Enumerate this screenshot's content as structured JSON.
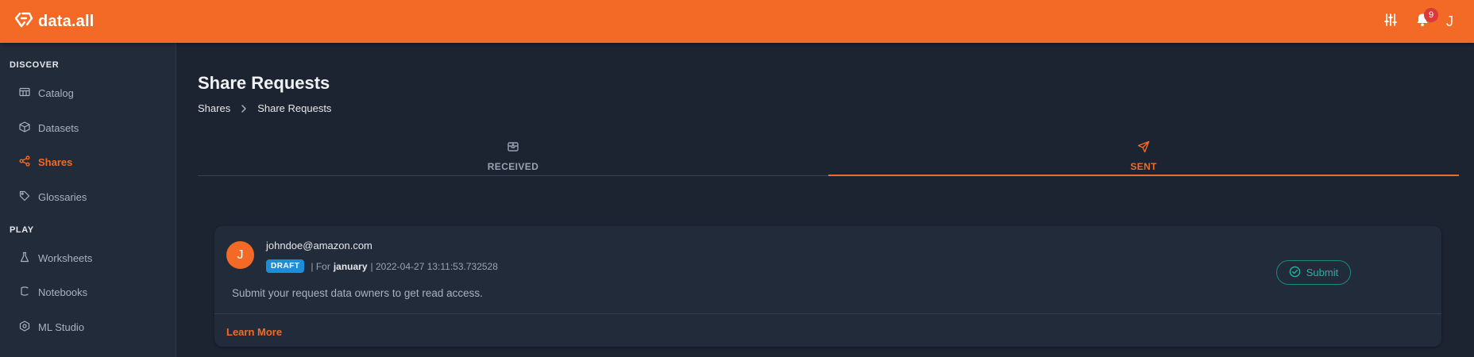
{
  "app": {
    "logo_text": "data.all"
  },
  "topbar": {
    "notification_count": "9",
    "user_initial": "J"
  },
  "sidebar": {
    "sections": [
      {
        "title": "DISCOVER",
        "items": [
          {
            "label": "Catalog",
            "icon": "catalog-icon",
            "active": false
          },
          {
            "label": "Datasets",
            "icon": "cube-icon",
            "active": false
          },
          {
            "label": "Shares",
            "icon": "share-icon",
            "active": true
          },
          {
            "label": "Glossaries",
            "icon": "tag-icon",
            "active": false
          }
        ]
      },
      {
        "title": "PLAY",
        "items": [
          {
            "label": "Worksheets",
            "icon": "flask-icon",
            "active": false
          },
          {
            "label": "Notebooks",
            "icon": "notebook-icon",
            "active": false
          },
          {
            "label": "ML Studio",
            "icon": "ml-icon",
            "active": false
          }
        ]
      }
    ]
  },
  "page": {
    "title": "Share Requests",
    "breadcrumb": [
      "Shares",
      "Share Requests"
    ]
  },
  "tabs": [
    {
      "label": "RECEIVED",
      "icon": "inbox-icon",
      "active": false
    },
    {
      "label": "SENT",
      "icon": "send-icon",
      "active": true
    }
  ],
  "request": {
    "avatar_initial": "J",
    "requester": "johndoe@amazon.com",
    "status": "DRAFT",
    "for_prefix": "| For",
    "target": "january",
    "timestamp": "| 2022-04-27 13:11:53.732528",
    "description": "Submit your request data owners to get read access.",
    "submit_label": "Submit",
    "learn_more_label": "Learn More"
  },
  "colors": {
    "accent": "#f26a25",
    "background": "#1c2331",
    "panel": "#222b3a",
    "badge_blue": "#1c8dd9",
    "success": "#22b4a0",
    "notification": "#d93a3a"
  }
}
